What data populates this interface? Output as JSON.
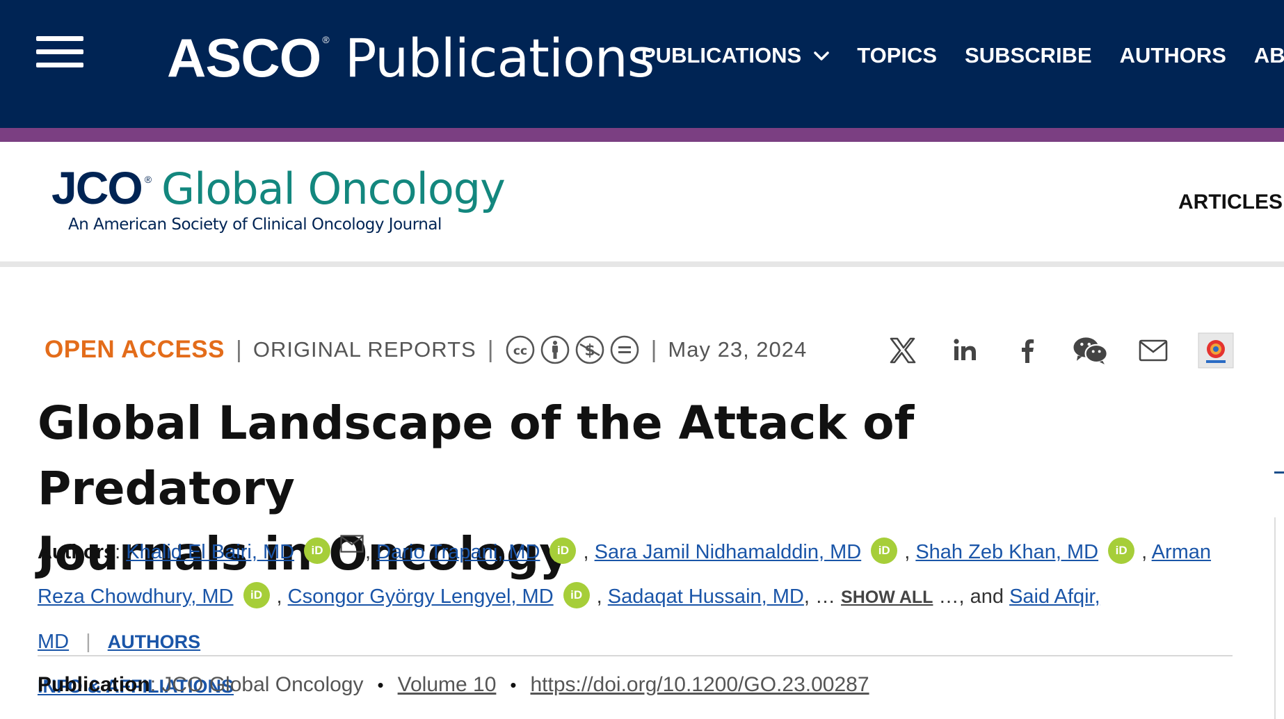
{
  "colors": {
    "topbar": "#002454",
    "stripe": "#7b3f82",
    "open_access": "#e36c1a",
    "journal_green": "#13877e",
    "link_blue": "#1a55a8",
    "orcid_green": "#a6ce39"
  },
  "header": {
    "menu_icon": "hamburger-menu-icon",
    "brand_main": "ASCO",
    "brand_reg": "®",
    "brand_sub": "Publications",
    "nav": [
      {
        "label": "PUBLICATIONS",
        "icon": "chevron-down-icon"
      },
      {
        "label": "TOPICS"
      },
      {
        "label": "SUBSCRIBE"
      },
      {
        "label": "AUTHORS"
      },
      {
        "label": "ABOUT"
      }
    ]
  },
  "journal": {
    "mark": "JCO",
    "mark_reg": "®",
    "title": "Global Oncology",
    "subtitle": "An American Society of Clinical Oncology Journal",
    "articles_label": "ARTICLES"
  },
  "article": {
    "access": "OPEN ACCESS",
    "sep": "|",
    "type": "ORIGINAL REPORTS",
    "license_icons": [
      "cc-icon",
      "attribution-icon",
      "noncommercial-icon",
      "noderivatives-icon"
    ],
    "date": "May 23, 2024",
    "share_icons": [
      "x-icon",
      "linkedin-icon",
      "facebook-icon",
      "wechat-icon",
      "email-icon",
      "mendeley-icon"
    ],
    "title_line1": "Global Landscape of the Attack of Predatory",
    "title_line2": "Journals in Oncology"
  },
  "authors": {
    "label": "Authors",
    "colon": ": ",
    "list": [
      "Khalid El Bairi, MD",
      "Dario Trapani, MD",
      "Sara Jamil Nidhamalddin, MD",
      "Shah Zeb Khan, MD",
      "Arman",
      "Reza Chowdhury, MD",
      "Csongor György Lengyel, MD",
      "Sadaqat Hussain, MD",
      "Said Afqir, MD"
    ],
    "orcid_text": "iD",
    "comma": ",",
    "ellipsis_before": ", …",
    "show_all": "SHOW ALL",
    "ellipsis_after": " …, and",
    "bar": "|",
    "affil_line1": "AUTHORS",
    "affil_line2": "INFO & AFFILIATIONS"
  },
  "publication": {
    "label": "Publication",
    "colon": ": ",
    "journal": "JCO Global Oncology",
    "bullet": "•",
    "volume": "Volume 10",
    "doi": "https://doi.org/10.1200/GO.23.00287"
  }
}
